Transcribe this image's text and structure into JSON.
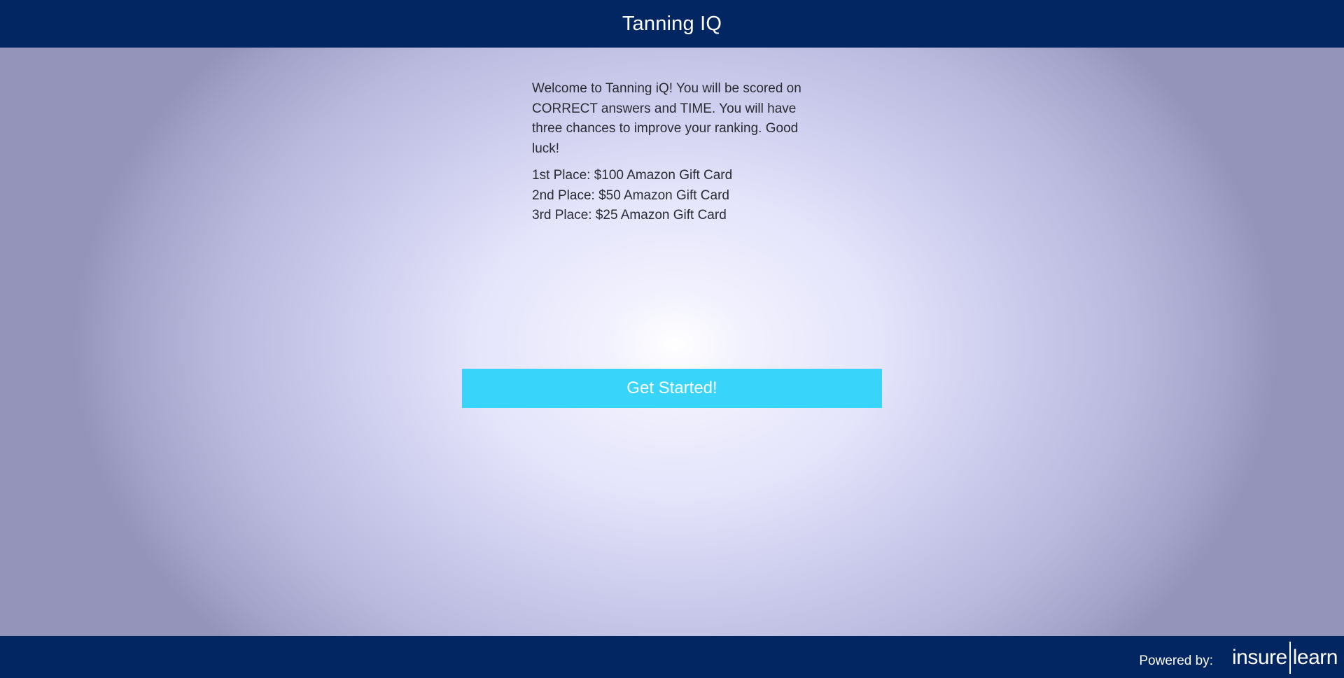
{
  "header": {
    "title": "Tanning IQ"
  },
  "intro": {
    "welcome": "Welcome to Tanning iQ! You will be scored on CORRECT answers and TIME. You will have three chances to improve your ranking. Good luck!",
    "prizes": [
      "1st Place: $100 Amazon Gift Card",
      "2nd Place: $50 Amazon Gift Card",
      "3rd Place: $25 Amazon Gift Card"
    ]
  },
  "actions": {
    "start_label": "Get Started!"
  },
  "footer": {
    "powered_by": "Powered by:",
    "logo_left": "insure",
    "logo_right": "learn"
  },
  "colors": {
    "header_bg": "#022662",
    "footer_bg": "#022662",
    "button_bg": "#38d4f9",
    "background_center": "#ffffff",
    "background_edge": "#9494ba"
  }
}
